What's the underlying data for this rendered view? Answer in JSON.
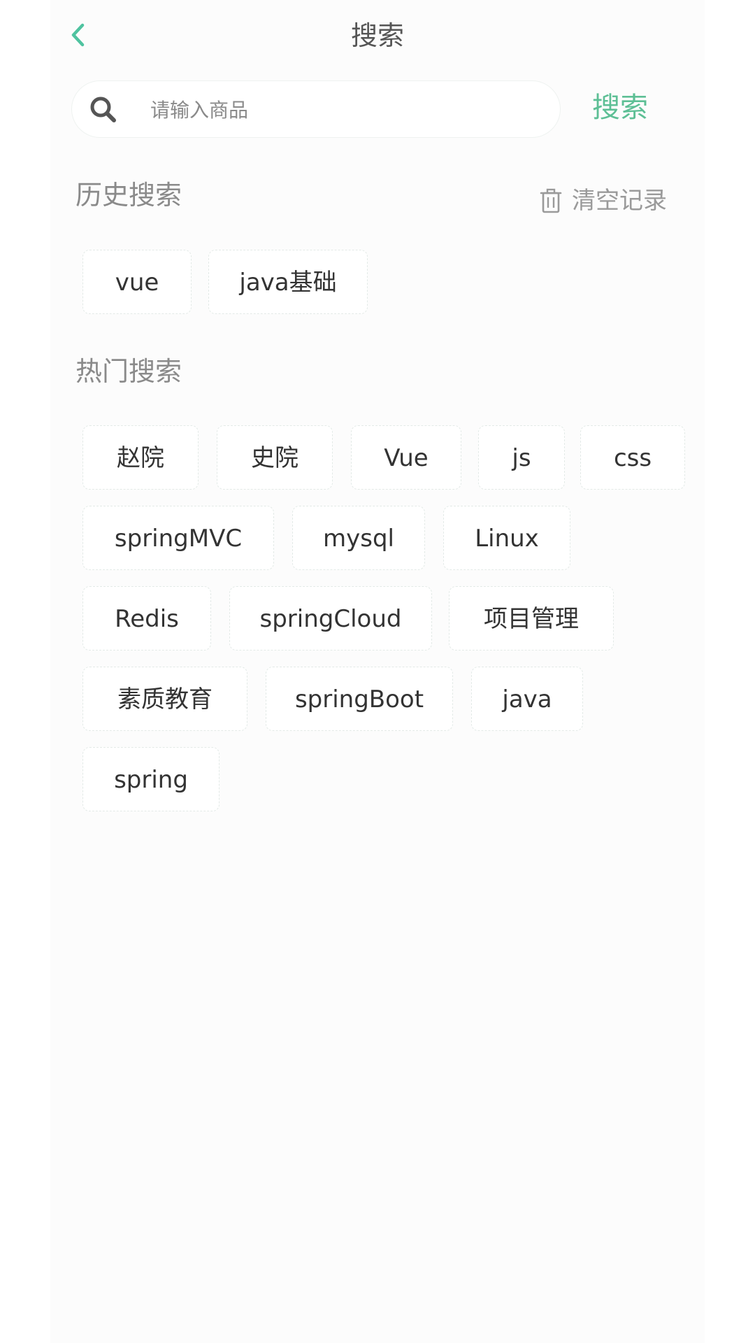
{
  "header": {
    "title": "搜索",
    "back_icon": "chevron-left-icon"
  },
  "search": {
    "placeholder": "请输入商品",
    "value": "",
    "button_label": "搜索",
    "icon": "search-icon"
  },
  "history": {
    "title": "历史搜索",
    "clear_label": "清空记录",
    "clear_icon": "trash-icon",
    "items": [
      "vue",
      "java基础"
    ]
  },
  "hot": {
    "title": "热门搜索",
    "items": [
      "赵院",
      "史院",
      "Vue",
      "js",
      "css",
      "springMVC",
      "mysql",
      "Linux",
      "Redis",
      "springCloud",
      "项目管理",
      "素质教育",
      "springBoot",
      "java",
      "spring"
    ]
  },
  "colors": {
    "accent": "#5dbf95",
    "back_arrow": "#4fc3a0",
    "muted_text": "#8a8a8a",
    "body_text": "#333333"
  }
}
